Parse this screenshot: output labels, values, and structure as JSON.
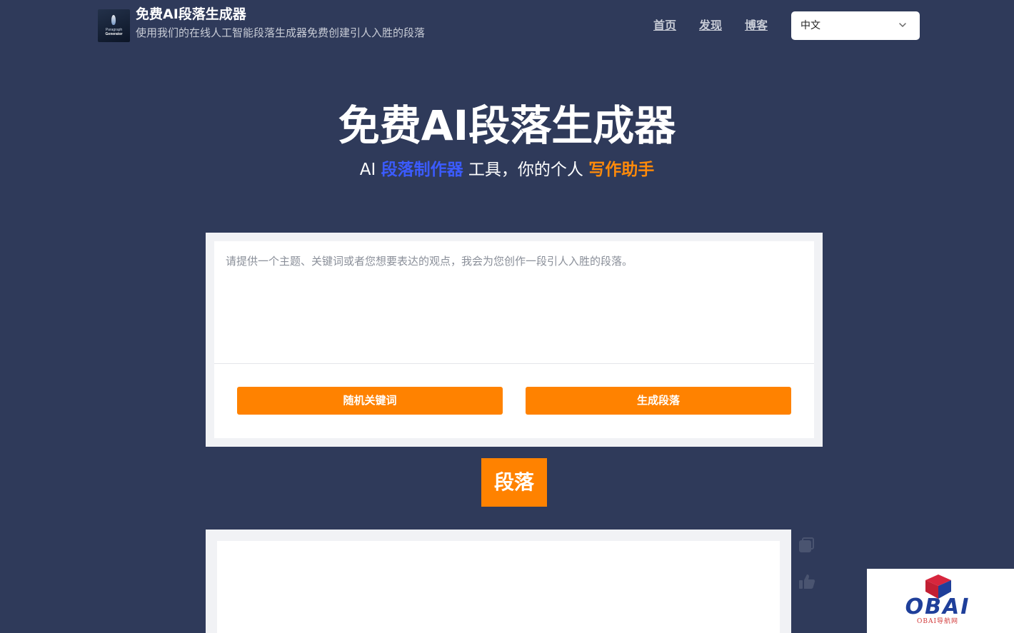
{
  "header": {
    "logo_line1": "Paragraph",
    "logo_line2": "Generator",
    "site_title": "免费AI段落生成器",
    "tagline": "使用我们的在线人工智能段落生成器免费创建引人入胜的段落",
    "nav": {
      "home": "首页",
      "discover": "发现",
      "blog": "博客"
    },
    "language": "中文"
  },
  "hero": {
    "title": "免费AI段落生成器",
    "sub_prefix": "AI ",
    "sub_highlight1": "段落制作器",
    "sub_middle": " 工具，你的个人 ",
    "sub_highlight2": "写作助手"
  },
  "input": {
    "placeholder": "请提供一个主题、关键词或者您想要表达的观点，我会为您创作一段引人入胜的段落。",
    "value": "",
    "random_button": "随机关键词",
    "generate_button": "生成段落"
  },
  "output": {
    "section_label": "段落"
  },
  "badge": {
    "title": "OBAI",
    "subtitle": "OBAI导航网"
  },
  "colors": {
    "background": "#2f3a5a",
    "accent_orange": "#ff8200",
    "accent_blue": "#3b5bff"
  },
  "icons": {
    "copy": "copy-icon",
    "like": "thumbs-up-icon",
    "dropdown": "chevron-down-icon"
  }
}
